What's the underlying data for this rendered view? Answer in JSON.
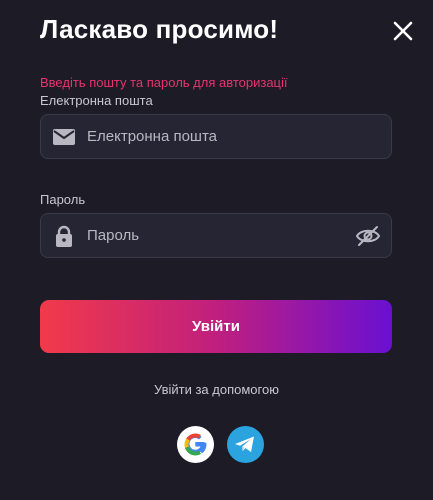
{
  "header": {
    "title": "Ласкаво просимо!"
  },
  "form": {
    "hint": "Введіть пошту та пароль для авторизації",
    "email": {
      "label": "Електронна пошта",
      "placeholder": "Електронна пошта",
      "value": ""
    },
    "password": {
      "label": "Пароль",
      "placeholder": "Пароль",
      "value": ""
    },
    "submit_label": "Увійти"
  },
  "social": {
    "label": "Увійти за допомогою",
    "providers": [
      "google-icon",
      "telegram-icon"
    ]
  },
  "colors": {
    "background": "#1c1b26",
    "field_bg": "#262533",
    "hint": "#e8336e",
    "gradient_start": "#f13a4a",
    "gradient_end": "#6a10d2",
    "telegram": "#2aa3df"
  }
}
